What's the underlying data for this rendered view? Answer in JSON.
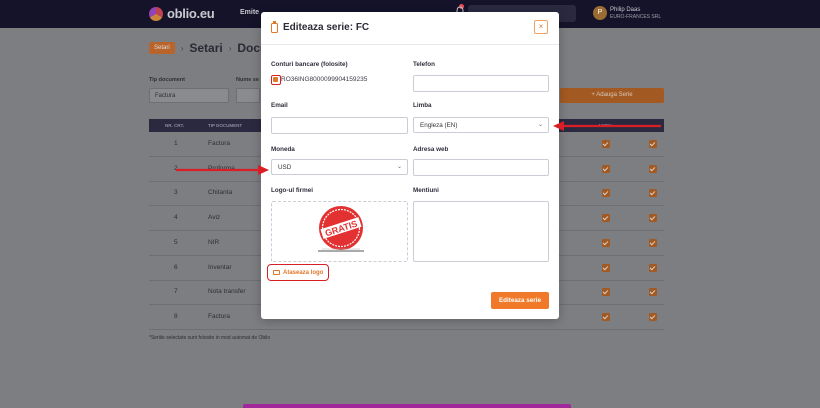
{
  "app": {
    "brand": "oblio.eu",
    "nav_item": "Emite",
    "user_name": "Philip Daas",
    "user_company": "EURO-FRANCES SRL",
    "user_initial": "P"
  },
  "page": {
    "crumb_badge": "Setari",
    "crumb_section": "Setari",
    "crumb_page": "Docum",
    "filter_tip_label": "Tip document",
    "filter_tip_value": "Factura",
    "filter_name_label": "Nume se",
    "add_serie_label": "+ Adauga Serie",
    "table_headers": {
      "nr": "NR. CRT.",
      "tip": "TIP DOCUMENT",
      "activ": "ACTIV"
    },
    "rows": [
      {
        "nr": "1",
        "tip": "Factura"
      },
      {
        "nr": "2",
        "tip": "Proforma"
      },
      {
        "nr": "3",
        "tip": "Chitanta"
      },
      {
        "nr": "4",
        "tip": "Aviz"
      },
      {
        "nr": "5",
        "tip": "NIR"
      },
      {
        "nr": "6",
        "tip": "Inventar"
      },
      {
        "nr": "7",
        "tip": "Nota transfer"
      },
      {
        "nr": "8",
        "tip": "Factura"
      }
    ],
    "footnote": "*Seriile selectate sunt folosite in mod automat de Oblio"
  },
  "modal": {
    "title": "Editeaza serie: FC",
    "close": "×",
    "accounts_label": "Conturi bancare (folosite)",
    "account_iban": "RO36ING8000099904159235",
    "account_checked": true,
    "phone_label": "Telefon",
    "phone_value": "",
    "email_label": "Email",
    "email_value": "",
    "language_label": "Limba",
    "language_value": "Engleza (EN)",
    "currency_label": "Moneda",
    "currency_value": "USD",
    "web_label": "Adresa web",
    "web_value": "",
    "logo_label": "Logo-ul firmei",
    "mentions_label": "Mentiuni",
    "stamp_text": "GRATIS",
    "attach_logo": "Ataseaza logo",
    "submit": "Editeaza serie"
  },
  "colors": {
    "accent": "#f07a2a",
    "annotation_red": "#d91f26",
    "topbar": "#14132a"
  }
}
